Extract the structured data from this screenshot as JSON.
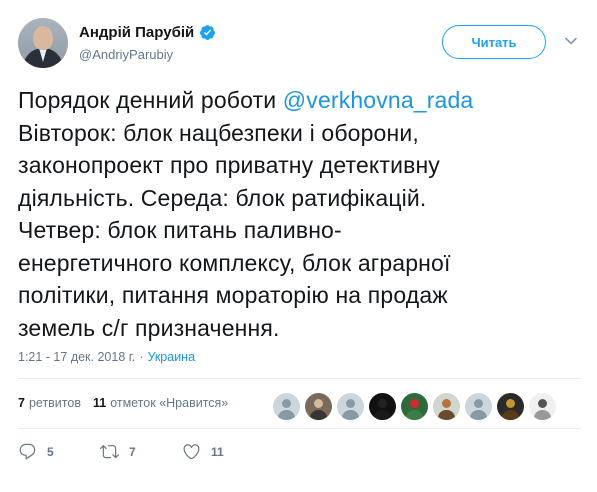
{
  "author": {
    "display_name": "Андрій Парубій",
    "handle": "@AndriyParubiy",
    "verified": true
  },
  "follow_button": {
    "label": "Читать"
  },
  "tweet": {
    "lines": [
      "Порядок денний роботи ",
      "Вівторок: блок нацбезпеки і оборони,",
      "законопроект про приватну детективну",
      "діяльність. Середа: блок ратифікацій.",
      "Четвер: блок питань паливно-",
      "енергетичного комплексу, блок аграрної",
      "політики, питання мораторію на продаж",
      "земель с/г призначення."
    ],
    "mention": "@verkhovna_rada"
  },
  "meta": {
    "time": "1:21 - 17 дек. 2018 г.",
    "separator": "·",
    "place": "Украина"
  },
  "stats": {
    "retweets_count": "7",
    "retweets_label": "ретвитов",
    "likes_count": "11",
    "likes_label": "отметок «Нравится»"
  },
  "likers": [
    {
      "name": "liker-1",
      "style": "default"
    },
    {
      "name": "liker-2",
      "style": "photo"
    },
    {
      "name": "liker-3",
      "style": "default"
    },
    {
      "name": "liker-4",
      "style": "black-cat"
    },
    {
      "name": "liker-5",
      "style": "flower"
    },
    {
      "name": "liker-6",
      "style": "cartoon"
    },
    {
      "name": "liker-7",
      "style": "default"
    },
    {
      "name": "liker-8",
      "style": "photo-dark"
    },
    {
      "name": "liker-9",
      "style": "cartoon-2"
    }
  ],
  "actions": {
    "reply_count": "5",
    "retweet_count": "7",
    "like_count": "11"
  },
  "colors": {
    "link": "#1b95e0",
    "accent": "#1da1f2",
    "muted": "#657786",
    "text": "#14171a"
  }
}
